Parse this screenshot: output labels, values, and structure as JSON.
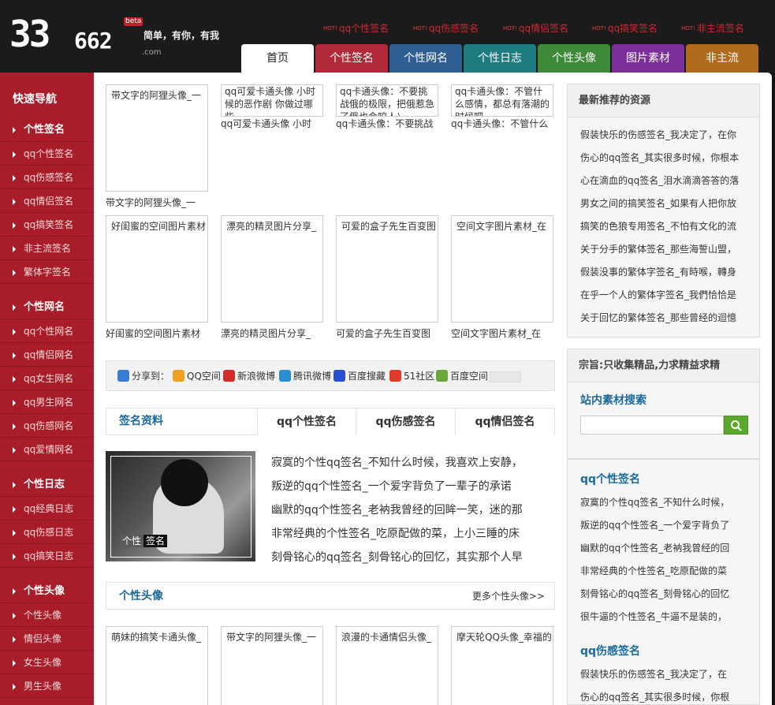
{
  "header": {
    "logo_big": "33",
    "logo_small": "662",
    "logo_domain": ".com",
    "logo_badge": "beta",
    "slogan": "简单，有你，有我",
    "hot_badge": "HOT!",
    "hot_links": [
      "qq个性签名",
      "qq伤感签名",
      "qq情侣签名",
      "qq搞笑签名",
      "非主流签名"
    ]
  },
  "nav": {
    "tabs": [
      {
        "label": "首页",
        "color": "#ffffff"
      },
      {
        "label": "个性签名",
        "color": "#b12a3b"
      },
      {
        "label": "个性网名",
        "color": "#2f5e93"
      },
      {
        "label": "个性日志",
        "color": "#1e7c80"
      },
      {
        "label": "个性头像",
        "color": "#3e8a3a"
      },
      {
        "label": "图片素材",
        "color": "#7b2f98"
      },
      {
        "label": "非主流",
        "color": "#b06a1e"
      }
    ],
    "active": "首页"
  },
  "sidebar": {
    "title": "快速导航",
    "items": [
      {
        "label": "个性签名",
        "head": true
      },
      {
        "label": "qq个性签名"
      },
      {
        "label": "qq伤感签名"
      },
      {
        "label": "qq情侣签名"
      },
      {
        "label": "qq搞笑签名"
      },
      {
        "label": "非主流签名"
      },
      {
        "label": "繁体字签名"
      },
      {
        "label": "个性网名",
        "head": true
      },
      {
        "label": "qq个性网名"
      },
      {
        "label": "qq情侣网名"
      },
      {
        "label": "qq女生网名"
      },
      {
        "label": "qq男生网名"
      },
      {
        "label": "qq伤感网名"
      },
      {
        "label": "qq爱情网名"
      },
      {
        "label": "个性日志",
        "head": true
      },
      {
        "label": "qq经典日志"
      },
      {
        "label": "qq伤感日志"
      },
      {
        "label": "qq搞笑日志"
      },
      {
        "label": "个性头像",
        "head": true
      },
      {
        "label": "个性头像"
      },
      {
        "label": "情侣头像"
      },
      {
        "label": "女生头像"
      },
      {
        "label": "男生头像"
      }
    ]
  },
  "main": {
    "row1": [
      {
        "type": "image",
        "alt": "带文字的阿狸头像_一",
        "caption": "带文字的阿狸头像_一"
      },
      {
        "type": "text",
        "title": "qq可爱卡通头像 小时候的恶作剧 你做过哪些",
        "caption": "qq可爱卡通头像 小时"
      },
      {
        "type": "text",
        "title": "qq卡通头像：不要挑战俄的极限，把俄惹急了俄也会咬人乀",
        "caption": "qq卡通头像：不要挑战"
      },
      {
        "type": "text",
        "title": "qq卡通头像：不管什么感情，都总有落潮的时候吧。",
        "caption": "qq卡通头像：不管什么"
      }
    ],
    "row2": [
      {
        "alt": "好闺蜜的空间图片素材",
        "caption": "好闺蜜的空间图片素材"
      },
      {
        "alt": "漂亮的精灵图片分享_",
        "caption": "漂亮的精灵图片分享_"
      },
      {
        "alt": "可爱的盒子先生百变图",
        "caption": "可爱的盒子先生百变图"
      },
      {
        "alt": "空间文字图片素材_在",
        "caption": "空间文字图片素材_在"
      }
    ],
    "share": {
      "label": "分享到：",
      "items": [
        {
          "label": "QQ空间",
          "color": "#f0a020"
        },
        {
          "label": "新浪微博",
          "color": "#d52b2b"
        },
        {
          "label": "腾讯微博",
          "color": "#2a8fd0"
        },
        {
          "label": "百度搜藏",
          "color": "#2a4fd0"
        },
        {
          "label": "51社区",
          "color": "#e03a2a"
        },
        {
          "label": "百度空间",
          "color": "#6aa83a"
        }
      ]
    },
    "sig_section": {
      "title": "签名资料",
      "tabs": [
        "qq个性签名",
        "qq伤感签名",
        "qq情侣签名"
      ],
      "photo_tags": [
        "个性",
        "签名"
      ],
      "lines": [
        "寂寞的个性qq签名_不知什么时候，我喜欢上安静，",
        "叛逆的qq个性签名_一个爱字背负了一辈子的承诺",
        "幽默的qq个性签名_老衲我曾经的回眸一笑，迷的那",
        "非常经典的个性签名_吃原配做的菜，上小三睡的床",
        "刻骨铭心的qq签名_刻骨铭心的回忆，其实那个人早"
      ]
    },
    "avatar_section": {
      "title": "个性头像",
      "more": "更多个性头像>>",
      "items": [
        "萌妹的搞笑卡通头像_",
        "带文字的阿狸头像_一",
        "浪漫的卡通情侣头像_",
        "摩天轮QQ头像_幸福的"
      ]
    }
  },
  "right": {
    "recommend": {
      "title": "最新推荐的资源",
      "lines": [
        "假装快乐的伤感签名_我决定了，在你",
        "伤心的qq签名_其实很多时候，你根本",
        "心在滴血的qq签名_泪水滴滴答答的落",
        "男女之间的搞笑签名_如果有人把你放",
        "搞笑的色狼专用签名_不怕有文化的流",
        "关于分手的繁体签名_那些海誓山盟，",
        "假装没事的繁体字签名_有時喉，轉身",
        "在乎一个人的繁体字签名_我們恰恰是",
        "关于回忆的繁体签名_那些曾经的迴憶"
      ]
    },
    "motto": "宗旨:只收集精品,力求精益求精",
    "search": {
      "title": "站内素材搜索",
      "placeholder": ""
    },
    "qq_sig": {
      "title": "qq个性签名",
      "lines": [
        "寂寞的个性qq签名_不知什么时候，",
        "叛逆的qq个性签名_一个爱字背负了",
        "幽默的qq个性签名_老衲我曾经的回",
        "非常经典的个性签名_吃原配做的菜",
        "刻骨铭心的qq签名_刻骨铭心的回忆",
        "很牛逼的个性签名_牛逼不是装的，"
      ]
    },
    "sad_sig": {
      "title": "qq伤感签名",
      "lines": [
        "假装快乐的伤感签名_我决定了，在",
        "伤心的qq签名_其实很多时候，你根"
      ]
    }
  }
}
